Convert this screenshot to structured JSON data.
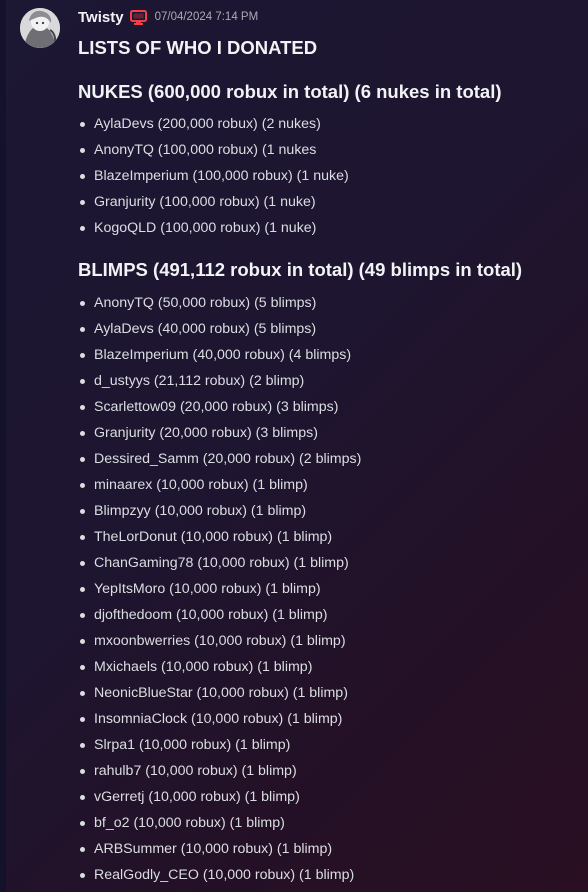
{
  "message": {
    "username": "Twisty",
    "timestamp": "07/04/2024 7:14 PM",
    "icons": {
      "avatar": "avatar-image",
      "platform": "desktop-monitor-icon"
    },
    "colors": {
      "platform_icon": "#f23f43",
      "text": "#dbdee1",
      "heading": "#f2f3f5"
    },
    "heading": "LISTS OF WHO I DONATED",
    "nukes": {
      "title": "NUKES (600,000 robux in total) (6 nukes in total)",
      "items": [
        "AylaDevs (200,000 robux) (2 nukes)",
        "AnonyTQ (100,000 robux) (1 nukes",
        "BlazeImperium (100,000 robux) (1 nuke)",
        "Granjurity (100,000 robux) (1 nuke)",
        "KogoQLD (100,000 robux) (1 nuke)"
      ]
    },
    "blimps": {
      "title": "BLIMPS (491,112 robux in total) (49 blimps in total)",
      "items": [
        "AnonyTQ (50,000 robux) (5 blimps)",
        "AylaDevs (40,000 robux) (5 blimps)",
        "BlazeImperium (40,000 robux) (4 blimps)",
        "d_ustyys (21,112 robux) (2 blimp)",
        "Scarlettow09 (20,000 robux) (3 blimps)",
        "Granjurity (20,000 robux) (3 blimps)",
        "Dessired_Samm (20,000 robux) (2 blimps)",
        "minaarex (10,000 robux) (1 blimp)",
        "Blimpzyy (10,000 robux) (1 blimp)",
        "TheLorDonut (10,000 robux) (1 blimp)",
        "ChanGaming78 (10,000 robux) (1 blimp)",
        "YepItsMoro (10,000 robux) (1 blimp)",
        "djofthedoom (10,000 robux) (1 blimp)",
        "mxoonbwerries (10,000 robux) (1 blimp)",
        "Mxichaels (10,000 robux) (1 blimp)",
        "NeonicBlueStar (10,000 robux) (1 blimp)",
        "InsomniaClock (10,000 robux) (1 blimp)",
        "Slrpa1 (10,000 robux) (1 blimp)",
        "rahulb7 (10,000 robux) (1 blimp)",
        "vGerretj (10,000 robux) (1 blimp)",
        "bf_o2 (10,000 robux) (1 blimp)",
        "ARBSummer (10,000 robux) (1 blimp)",
        "RealGodly_CEO (10,000 robux) (1 blimp)"
      ]
    }
  }
}
